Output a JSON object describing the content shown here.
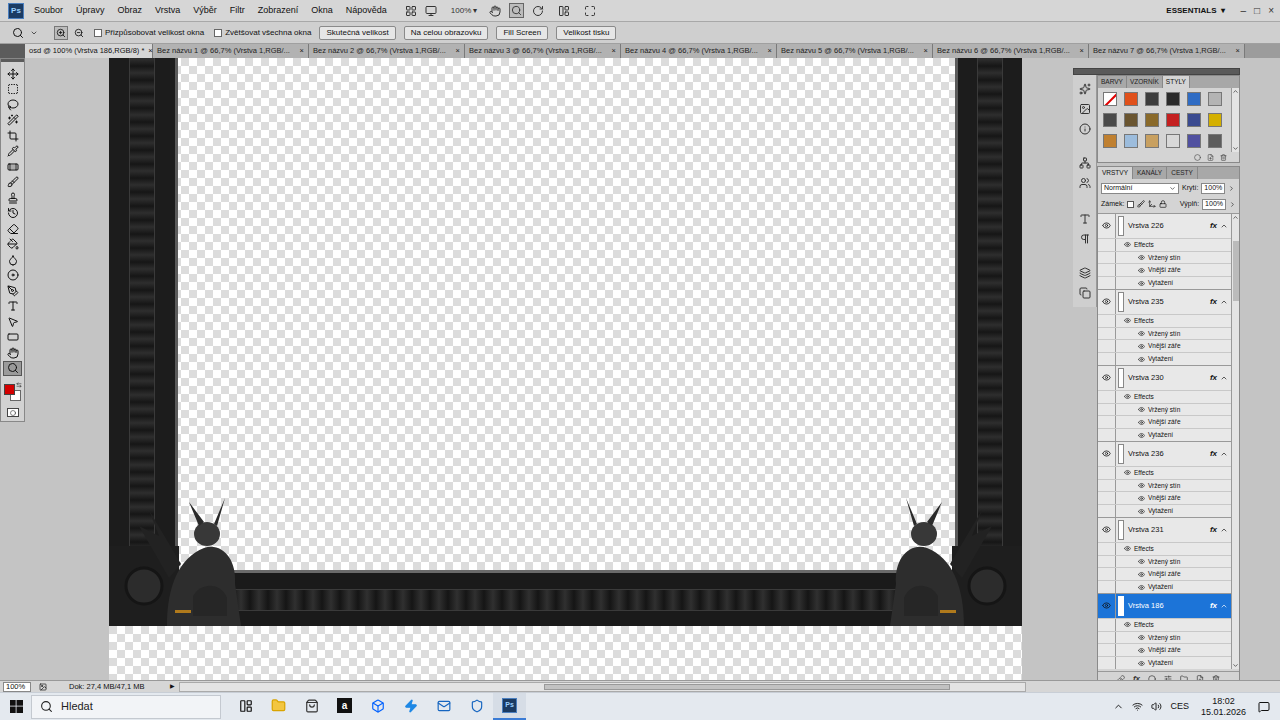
{
  "app": {
    "logo": "Ps"
  },
  "menu": [
    "Soubor",
    "Úpravy",
    "Obraz",
    "Vrstva",
    "Výběr",
    "Filtr",
    "Zobrazení",
    "Okna",
    "Nápověda"
  ],
  "app_bar": {
    "zoom": "100%",
    "zoom_arrow": "▾",
    "workspace": "ESSENTIALS",
    "workspace_arrow": "▾"
  },
  "window_controls": [
    "–",
    "□",
    "×"
  ],
  "options_bar": {
    "checkboxes": [
      {
        "label": "Přizpůsobovat velikost okna",
        "checked": false
      },
      {
        "label": "Zvětšovat všechna okna",
        "checked": false
      }
    ],
    "buttons": [
      "Skutečná velikost",
      "Na celou obrazovku",
      "Fill Screen",
      "Velikost tisku"
    ]
  },
  "document_tabs": [
    {
      "label": "osd @ 100% (Vrstva 186,RGB/8) *",
      "selected": true,
      "close": "×"
    },
    {
      "label": "Bez názvu 1 @ 66,7% (Vrstva 1,RGB/...",
      "selected": false,
      "close": "×"
    },
    {
      "label": "Bez názvu 2 @ 66,7% (Vrstva 1,RGB/...",
      "selected": false,
      "close": "×"
    },
    {
      "label": "Bez názvu 3 @ 66,7% (Vrstva 1,RGB/...",
      "selected": false,
      "close": "×"
    },
    {
      "label": "Bez názvu 4 @ 66,7% (Vrstva 1,RGB/...",
      "selected": false,
      "close": "×"
    },
    {
      "label": "Bez názvu 5 @ 66,7% (Vrstva 1,RGB/...",
      "selected": false,
      "close": "×"
    },
    {
      "label": "Bez názvu 6 @ 66,7% (Vrstva 1,RGB/...",
      "selected": false,
      "close": "×"
    },
    {
      "label": "Bez názvu 7 @ 66,7% (Vrstva 1,RGB/...",
      "selected": false,
      "close": "×"
    }
  ],
  "toolbox": {
    "tools": [
      {
        "kind": "move",
        "selected": false
      },
      {
        "kind": "marquee",
        "selected": false
      },
      {
        "kind": "lasso",
        "selected": false
      },
      {
        "kind": "quick-select",
        "selected": false
      },
      {
        "kind": "crop",
        "selected": false
      },
      {
        "kind": "eyedropper",
        "selected": false
      },
      {
        "kind": "healing",
        "selected": false
      },
      {
        "kind": "brush",
        "selected": false
      },
      {
        "kind": "stamp",
        "selected": false
      },
      {
        "kind": "history-brush",
        "selected": false
      },
      {
        "kind": "eraser",
        "selected": false
      },
      {
        "kind": "bucket",
        "selected": false
      },
      {
        "kind": "blur",
        "selected": false
      },
      {
        "kind": "dodge",
        "selected": false
      },
      {
        "kind": "pen",
        "selected": false
      },
      {
        "kind": "type",
        "selected": false
      },
      {
        "kind": "path-select",
        "selected": false
      },
      {
        "kind": "shape",
        "selected": false
      },
      {
        "kind": "hand",
        "selected": false
      },
      {
        "kind": "zoom",
        "selected": true
      }
    ],
    "foreground": "#d40000",
    "background": "#ffffff"
  },
  "styles_panel": {
    "tabs": [
      {
        "label": "BARVY",
        "selected": false
      },
      {
        "label": "VZORNÍK",
        "selected": false
      },
      {
        "label": "STYLY",
        "selected": true
      }
    ],
    "swatches": [
      {
        "kind": "none",
        "color": "#ffffff"
      },
      {
        "kind": "style",
        "color": "#e0501a"
      },
      {
        "kind": "style",
        "color": "#3c3c3c"
      },
      {
        "kind": "style",
        "color": "#2a2a2a"
      },
      {
        "kind": "style",
        "color": "#2f6cc4"
      },
      {
        "kind": "style",
        "color": "#b4b4b4"
      },
      {
        "kind": "style",
        "color": "#4a4a4a"
      },
      {
        "kind": "style",
        "color": "#6a5530"
      },
      {
        "kind": "style",
        "color": "#8a6a2a"
      },
      {
        "kind": "style",
        "color": "#c42020"
      },
      {
        "kind": "style",
        "color": "#3a4a90"
      },
      {
        "kind": "style",
        "color": "#d4b000"
      },
      {
        "kind": "style",
        "color": "#c08030"
      },
      {
        "kind": "style",
        "color": "#9cbcdc"
      },
      {
        "kind": "style",
        "color": "#c8a060"
      },
      {
        "kind": "style",
        "color": "#d8d8d8"
      },
      {
        "kind": "style",
        "color": "#5050a0"
      },
      {
        "kind": "style",
        "color": "#5c5c5c"
      }
    ]
  },
  "layers_panel": {
    "tabs": [
      {
        "label": "VRSTVY",
        "selected": true
      },
      {
        "label": "KANÁLY",
        "selected": false
      },
      {
        "label": "CESTY",
        "selected": false
      }
    ],
    "blend_mode": "Normální",
    "opacity_label": "Krytí:",
    "opacity": "100%",
    "lock_label": "Zámek:",
    "fill_label": "Výplň:",
    "fill": "100%",
    "fx_label": "fx",
    "layers": [
      {
        "name": "Vrstva 226",
        "selected": false,
        "visible": true,
        "effects_label": "Effects",
        "effects": [
          "Vržený stín",
          "Vnější záře",
          "Vytažení"
        ]
      },
      {
        "name": "Vrstva 235",
        "selected": false,
        "visible": true,
        "effects_label": "Effects",
        "effects": [
          "Vržený stín",
          "Vnější záře",
          "Vytažení"
        ]
      },
      {
        "name": "Vrstva 230",
        "selected": false,
        "visible": true,
        "effects_label": "Effects",
        "effects": [
          "Vržený stín",
          "Vnější záře",
          "Vytažení"
        ]
      },
      {
        "name": "Vrstva 236",
        "selected": false,
        "visible": true,
        "effects_label": "Effects",
        "effects": [
          "Vržený stín",
          "Vnější záře",
          "Vytažení"
        ]
      },
      {
        "name": "Vrstva 231",
        "selected": false,
        "visible": true,
        "effects_label": "Effects",
        "effects": [
          "Vržený stín",
          "Vnější záře",
          "Vytažení"
        ]
      },
      {
        "name": "Vrstva 186",
        "selected": true,
        "visible": true,
        "effects_label": "Effects",
        "effects": [
          "Vržený stín",
          "Vnější záře",
          "Vytažení"
        ]
      }
    ]
  },
  "status_bar": {
    "zoom": "100%",
    "doc": "Dok: 27,4 MB/47,1 MB",
    "arrow": "▶"
  },
  "taskbar": {
    "search": "Hledat",
    "apps": [
      {
        "kind": "task-view",
        "label": "",
        "selected": false
      },
      {
        "kind": "explorer",
        "label": "",
        "selected": false
      },
      {
        "kind": "store",
        "label": "",
        "selected": false
      },
      {
        "kind": "amazon",
        "label": "a",
        "selected": false
      },
      {
        "kind": "dropbox",
        "label": "",
        "selected": false
      },
      {
        "kind": "app",
        "label": "",
        "selected": false
      },
      {
        "kind": "mail",
        "label": "",
        "selected": false
      },
      {
        "kind": "defender",
        "label": "",
        "selected": false
      },
      {
        "kind": "photoshop",
        "label": "Ps",
        "selected": true
      }
    ],
    "language": "CES",
    "time": "18:02",
    "date": "15.01.2026"
  }
}
